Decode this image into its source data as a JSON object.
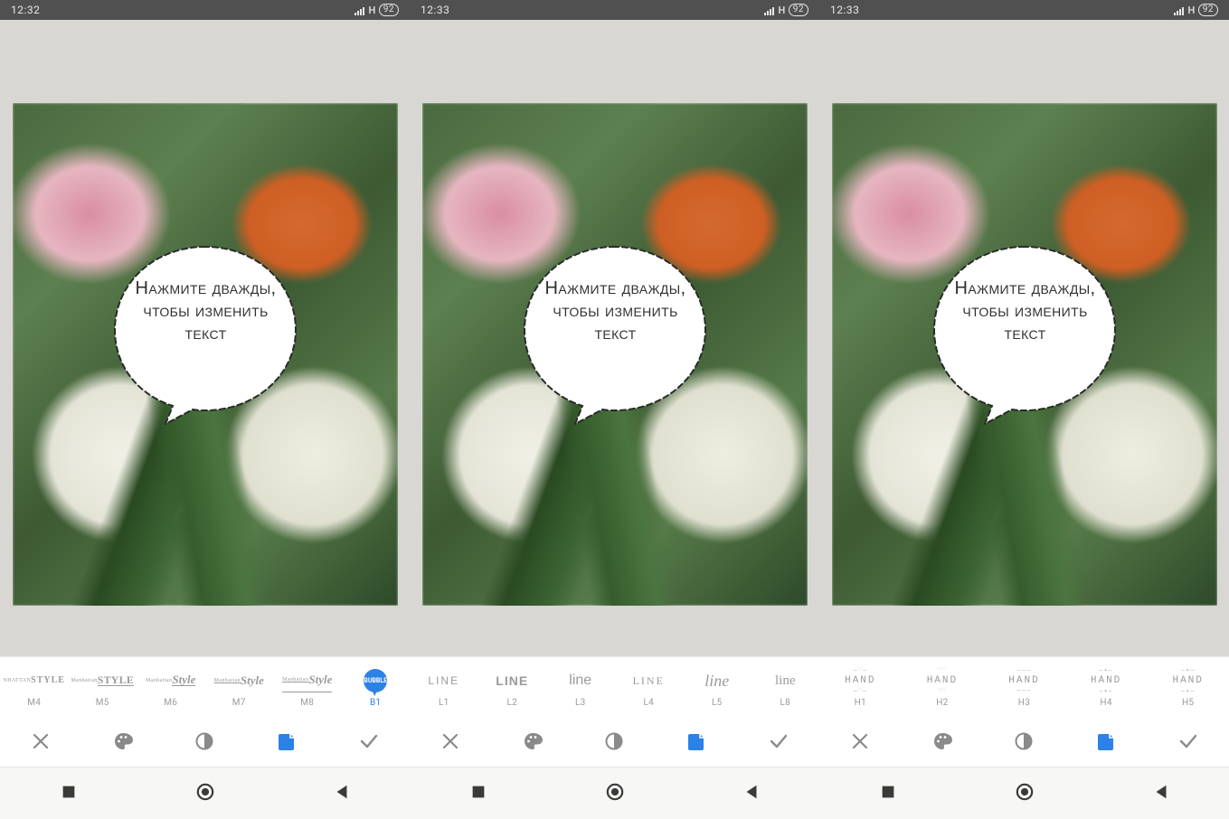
{
  "screens": [
    {
      "status": {
        "time": "12:32",
        "network": "H",
        "battery": "92"
      },
      "bubble": {
        "line1": "Нажмите дважды,",
        "line2": "чтобы изменить",
        "line3": "текст"
      },
      "active_style": "B1",
      "active_tool": "sticker"
    },
    {
      "status": {
        "time": "12:33",
        "network": "H",
        "battery": "92"
      },
      "bubble": {
        "line1": "Нажмите дважды,",
        "line2": "чтобы изменить",
        "line3": "текст"
      },
      "active_style": "B1",
      "active_tool": "sticker"
    },
    {
      "status": {
        "time": "12:33",
        "network": "H",
        "battery": "92"
      },
      "bubble": {
        "line1": "Нажмите дважды,",
        "line2": "чтобы изменить",
        "line3": "текст"
      },
      "active_style": "B1",
      "active_tool": "sticker"
    }
  ],
  "styles": [
    {
      "code": "M4",
      "preview_top": "NHATTAN",
      "preview_bot": "STYLE",
      "variant": "manhattan m4"
    },
    {
      "code": "M5",
      "preview_top": "Manhattan",
      "preview_bot": "STYLE",
      "variant": "manhattan m5"
    },
    {
      "code": "M6",
      "preview_top": "Manhattan",
      "preview_bot": "Style",
      "variant": "manhattan m6"
    },
    {
      "code": "M7",
      "preview_top": "Manhattan",
      "preview_bot": "Style",
      "variant": "manhattan m7"
    },
    {
      "code": "M8",
      "preview_top": "Manhattan",
      "preview_bot": "Style",
      "variant": "manhattan m8"
    },
    {
      "code": "B1",
      "preview": "BUBBLE",
      "variant": "bubble-badge"
    },
    {
      "code": "L1",
      "preview": "LINE",
      "variant": "line-sans"
    },
    {
      "code": "L2",
      "preview": "LINE",
      "variant": "line-bold"
    },
    {
      "code": "L3",
      "preview": "line",
      "variant": "line-light"
    },
    {
      "code": "L4",
      "preview": "LINE",
      "variant": "line-serif"
    },
    {
      "code": "L5",
      "preview": "line",
      "variant": "line-script"
    },
    {
      "code": "L8",
      "preview": "line",
      "variant": "line-hand"
    },
    {
      "code": "H1",
      "preview": "HAND",
      "variant": "hand",
      "deco": "—♡—"
    },
    {
      "code": "H2",
      "preview": "HAND",
      "variant": "hand",
      "deco": "♡♡"
    },
    {
      "code": "H3",
      "preview": "HAND",
      "variant": "hand",
      "deco": "———"
    },
    {
      "code": "H4",
      "preview": "HAND",
      "variant": "hand",
      "deco": "—✦—"
    },
    {
      "code": "H5",
      "preview": "HAND",
      "variant": "hand",
      "deco": "—✦—"
    }
  ],
  "tools": [
    {
      "id": "close",
      "icon": "close-icon"
    },
    {
      "id": "palette",
      "icon": "palette-icon"
    },
    {
      "id": "opacity",
      "icon": "opacity-icon"
    },
    {
      "id": "sticker",
      "icon": "sticker-icon"
    },
    {
      "id": "confirm",
      "icon": "check-icon"
    }
  ],
  "nav": [
    {
      "id": "recent",
      "icon": "square-icon"
    },
    {
      "id": "home",
      "icon": "circle-icon"
    },
    {
      "id": "back",
      "icon": "triangle-icon"
    }
  ],
  "colors": {
    "accent": "#2c81e6",
    "muted": "#9a9a9a",
    "statusbar": "#505050",
    "canvas_bg": "#d9d7d4"
  }
}
